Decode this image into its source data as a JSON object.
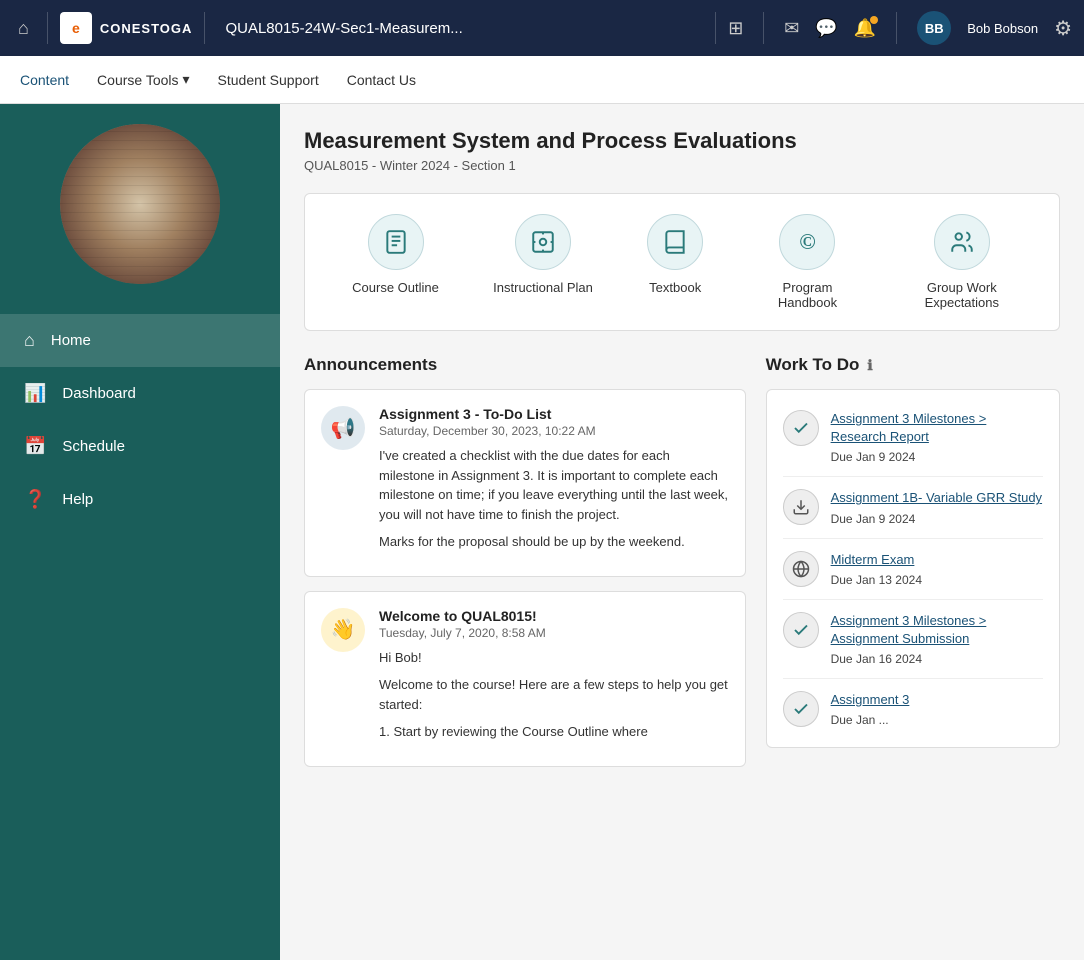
{
  "topbar": {
    "logo_text": "CONESTOGA",
    "logo_letter": "e",
    "course_title": "QUAL8015-24W-Sec1-Measurem...",
    "user_initials": "BB",
    "user_name": "Bob Bobson"
  },
  "secondary_nav": {
    "items": [
      {
        "label": "Content",
        "active": true
      },
      {
        "label": "Course Tools",
        "has_arrow": true
      },
      {
        "label": "Student Support",
        "has_arrow": false
      },
      {
        "label": "Contact Us",
        "has_arrow": false
      }
    ]
  },
  "sidebar": {
    "nav_items": [
      {
        "label": "Home",
        "icon": "🏠",
        "active": true
      },
      {
        "label": "Dashboard",
        "icon": "📊",
        "active": false
      },
      {
        "label": "Schedule",
        "icon": "📅",
        "active": false
      },
      {
        "label": "Help",
        "icon": "❓",
        "active": false
      }
    ]
  },
  "course": {
    "title": "Measurement System and Process Evaluations",
    "subtitle": "QUAL8015 - Winter 2024 - Section 1"
  },
  "quick_links": [
    {
      "label": "Course Outline",
      "icon": "📄"
    },
    {
      "label": "Instructional Plan",
      "icon": "📷"
    },
    {
      "label": "Textbook",
      "icon": "📖"
    },
    {
      "label": "Program Handbook",
      "icon": "©"
    },
    {
      "label": "Group Work Expectations",
      "icon": "👥"
    }
  ],
  "announcements": {
    "title": "Announcements",
    "items": [
      {
        "title": "Assignment 3 - To-Do List",
        "date": "Saturday, December 30, 2023, 10:22 AM",
        "icon": "📢",
        "icon_style": "default",
        "body": [
          "I've created a checklist with the due dates for each milestone in Assignment 3. It is important to complete each milestone on time; if you leave everything until the last week, you will not have time to finish the project.",
          "Marks for the proposal should be up by the weekend."
        ]
      },
      {
        "title": "Welcome to QUAL8015!",
        "date": "Tuesday, July 7, 2020, 8:58 AM",
        "icon": "👋",
        "icon_style": "yellow",
        "body": [
          "Hi Bob!",
          "Welcome to the course!  Here are a few steps to help you get started:",
          "1. Start by reviewing the Course Outline where"
        ]
      }
    ]
  },
  "work_todo": {
    "title": "Work To Do",
    "items": [
      {
        "label": "Assignment 3 Milestones > Research Report",
        "due": "Due Jan 9 2024",
        "icon": "✓",
        "icon_type": "check"
      },
      {
        "label": "Assignment 1B- Variable GRR Study",
        "due": "Due Jan 9 2024",
        "icon": "⬇",
        "icon_type": "download"
      },
      {
        "label": "Midterm Exam",
        "due": "Due Jan 13 2024",
        "icon": "🔵",
        "icon_type": "globe"
      },
      {
        "label": "Assignment 3 Milestones > Assignment Submission",
        "due": "Due Jan 16 2024",
        "icon": "✓",
        "icon_type": "check"
      },
      {
        "label": "Assignment 3",
        "due": "Due Jan ...",
        "icon": "✓",
        "icon_type": "check"
      }
    ]
  }
}
